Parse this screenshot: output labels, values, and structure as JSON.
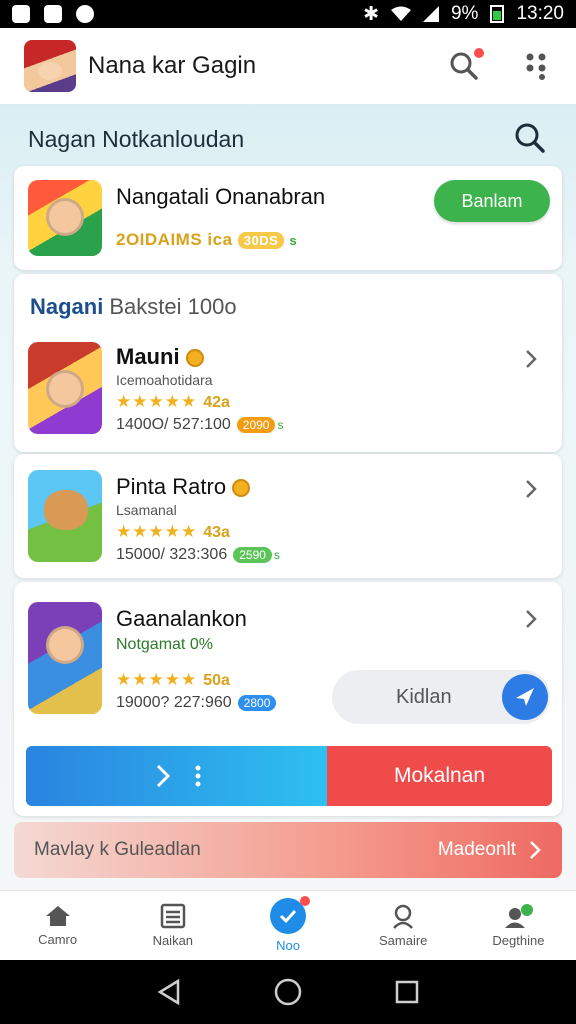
{
  "status_bar": {
    "battery": "9%",
    "time": "13:20"
  },
  "app": {
    "title": "Nana kar Gagin"
  },
  "section": {
    "heading": "Nagan Notkanloudan"
  },
  "featured": {
    "title": "Nangatali Onanabran",
    "meta": "2OIDAIMS ica",
    "meta_pill": "30DS",
    "meta_suffix": "s",
    "button": "Banlam"
  },
  "list": {
    "head_accent": "Nagani",
    "head_rest": "Bakstei 100o",
    "items": [
      {
        "title": "Mauni",
        "subtitle": "Icemoahotidara",
        "stars": "★★★★★",
        "rating": "42a",
        "stats": "1400O/ 527:100",
        "tag": "2090",
        "tag_suffix": "s"
      },
      {
        "title": "Pinta Ratro",
        "subtitle": "Lsamanal",
        "stars": "★★★★★",
        "rating": "43a",
        "stats": "15000/ 323:306",
        "tag": "2590",
        "tag_suffix": "s"
      },
      {
        "title": "Gaanalankon",
        "subtitle": "Notgamat 0%",
        "stars": "★★★★★",
        "rating": "50a",
        "stats": "19000? 227:960",
        "tag": "2800",
        "tag_suffix": ""
      }
    ]
  },
  "download": {
    "label": "Kidlan"
  },
  "action_bar": {
    "right_label": "Mokalnan"
  },
  "banner": {
    "left": "Mavlay k Guleadlan",
    "right": "Madeonlt"
  },
  "bottom_nav": [
    {
      "label": "Camro"
    },
    {
      "label": "Naikan"
    },
    {
      "label": "Noo"
    },
    {
      "label": "Samaire"
    },
    {
      "label": "Degthine"
    }
  ],
  "colors": {
    "accent_blue": "#1f8de8",
    "green_button": "#3db34d",
    "red_action": "#ef4b4b",
    "star": "#f2b01e"
  }
}
